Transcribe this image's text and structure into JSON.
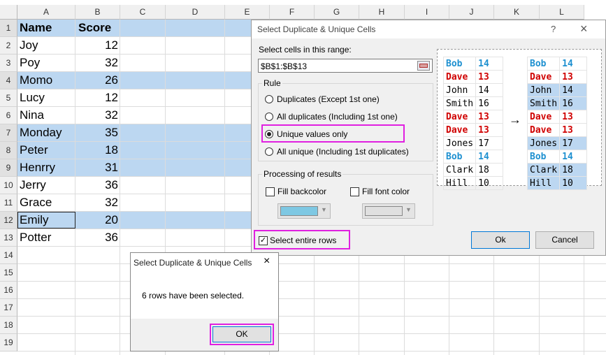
{
  "sheet": {
    "columns": [
      "A",
      "B",
      "C",
      "D",
      "E",
      "F",
      "G",
      "H",
      "I",
      "J",
      "K",
      "L"
    ],
    "rows": [
      "1",
      "2",
      "3",
      "4",
      "5",
      "6",
      "7",
      "8",
      "9",
      "10",
      "11",
      "12",
      "13",
      "14",
      "15",
      "16",
      "17",
      "18",
      "19"
    ],
    "headers": {
      "name": "Name",
      "score": "Score"
    },
    "data": [
      {
        "name": "Joy",
        "score": "12"
      },
      {
        "name": "Poy",
        "score": "32"
      },
      {
        "name": "Momo",
        "score": "26"
      },
      {
        "name": "Lucy",
        "score": "12"
      },
      {
        "name": "Nina",
        "score": "32"
      },
      {
        "name": "Monday",
        "score": "35"
      },
      {
        "name": "Peter",
        "score": "18"
      },
      {
        "name": "Henrry",
        "score": "31"
      },
      {
        "name": "Jerry",
        "score": "36"
      },
      {
        "name": "Grace",
        "score": "32"
      },
      {
        "name": "Emily",
        "score": "20"
      },
      {
        "name": "Potter",
        "score": "36"
      }
    ],
    "highlight_color": "#bcd7f1"
  },
  "main_dialog": {
    "title": "Select Duplicate & Unique Cells",
    "help": "?",
    "close": "×",
    "range_label": "Select cells in this range:",
    "range_value": "$B$1:$B$13",
    "rule_label": "Rule",
    "rules": [
      {
        "label": "Duplicates (Except 1st one)",
        "selected": false
      },
      {
        "label": "All duplicates (Including 1st one)",
        "selected": false
      },
      {
        "label": "Unique values only",
        "selected": true
      },
      {
        "label": "All unique (Including 1st duplicates)",
        "selected": false
      }
    ],
    "processing_label": "Processing of results",
    "fill_backcolor": "Fill backcolor",
    "fill_font_color": "Fill font color",
    "backcolor_swatch": "#7ec8e3",
    "fontcolor_swatch": "#e0e0e0",
    "select_entire_rows": "Select entire rows",
    "ok": "Ok",
    "cancel": "Cancel",
    "preview_left": [
      [
        "Bob",
        "14",
        "blue"
      ],
      [
        "Dave",
        "13",
        "red"
      ],
      [
        "John",
        "14",
        "black"
      ],
      [
        "Smith",
        "16",
        "black"
      ],
      [
        "Dave",
        "13",
        "red"
      ],
      [
        "Dave",
        "13",
        "red"
      ],
      [
        "Jones",
        "17",
        "black"
      ],
      [
        "Bob",
        "14",
        "blue"
      ],
      [
        "Clark",
        "18",
        "black"
      ],
      [
        "Hill",
        "10",
        "black"
      ]
    ],
    "preview_right": [
      [
        "Bob",
        "14",
        "blue",
        false
      ],
      [
        "Dave",
        "13",
        "red",
        false
      ],
      [
        "John",
        "14",
        "black",
        true
      ],
      [
        "Smith",
        "16",
        "black",
        true
      ],
      [
        "Dave",
        "13",
        "red",
        false
      ],
      [
        "Dave",
        "13",
        "red",
        false
      ],
      [
        "Jones",
        "17",
        "black",
        true
      ],
      [
        "Bob",
        "14",
        "blue",
        false
      ],
      [
        "Clark",
        "18",
        "black",
        true
      ],
      [
        "Hill",
        "10",
        "black",
        true
      ]
    ],
    "arrow": "→"
  },
  "msg_dialog": {
    "title": "Select Duplicate & Unique Cells",
    "close": "×",
    "message": "6 rows have been selected.",
    "ok": "OK"
  }
}
